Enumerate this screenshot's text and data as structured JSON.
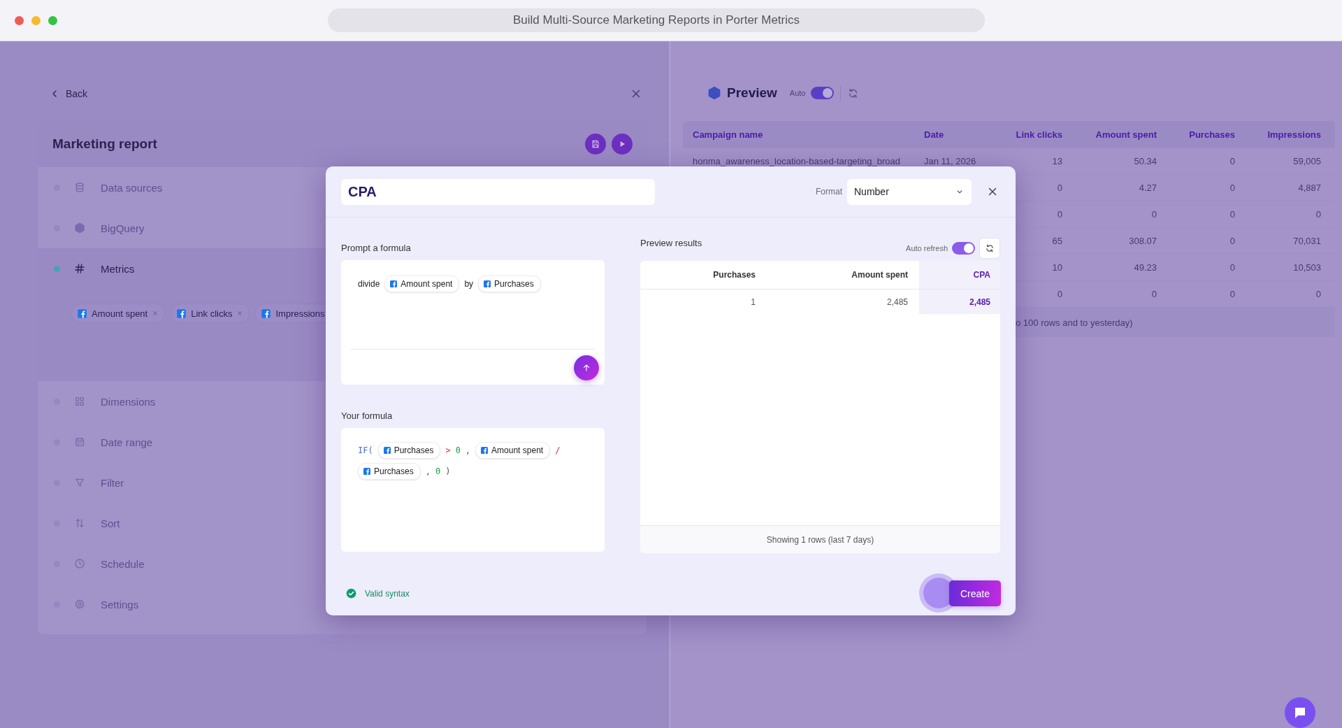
{
  "window": {
    "title": "Build Multi-Source Marketing Reports in Porter Metrics"
  },
  "editor": {
    "back": "Back",
    "report_title": "Marketing report",
    "sections": [
      {
        "kind": "database",
        "label": "Data sources",
        "active": false
      },
      {
        "kind": "bigquery",
        "label": "BigQuery",
        "active": false
      },
      {
        "kind": "hash",
        "label": "Metrics",
        "active": true,
        "chips": [
          "Amount spent",
          "Link clicks",
          "Impressions"
        ]
      },
      {
        "kind": "grid",
        "label": "Dimensions",
        "active": false
      },
      {
        "kind": "calendar",
        "label": "Date range",
        "active": false
      },
      {
        "kind": "filter",
        "label": "Filter",
        "active": false
      },
      {
        "kind": "sort",
        "label": "Sort",
        "active": false
      },
      {
        "kind": "clock",
        "label": "Schedule",
        "active": false
      },
      {
        "kind": "gear",
        "label": "Settings",
        "active": false
      }
    ]
  },
  "preview": {
    "title": "Preview",
    "auto_label": "Auto",
    "auto_on": true,
    "table": {
      "columns": [
        "Campaign name",
        "Date",
        "Link clicks",
        "Amount spent",
        "Purchases",
        "Impressions"
      ],
      "rows": [
        [
          "honma_awareness_location-based-targeting_broad",
          "Jan 11, 2026",
          "13",
          "50.34",
          "0",
          "59,005"
        ],
        [
          "0",
          "4.27",
          "0",
          "4,887"
        ],
        [
          "0",
          "0",
          "0",
          "0"
        ],
        [
          "65",
          "308.07",
          "0",
          "70,031"
        ],
        [
          "10",
          "49.23",
          "0",
          "10,503"
        ],
        [
          "0",
          "0",
          "0",
          "0"
        ]
      ]
    },
    "footnote": "o 100 rows and to yesterday)"
  },
  "dialog": {
    "name": "CPA",
    "format_label": "Format",
    "format": "Number",
    "prompt_label": "Prompt a formula",
    "prompt": [
      {
        "kind": "word",
        "text": "divide"
      },
      {
        "kind": "metric",
        "text": "Amount spent"
      },
      {
        "kind": "word",
        "text": "by"
      },
      {
        "kind": "metric",
        "text": "Purchases"
      }
    ],
    "formula_label": "Your formula",
    "formula": [
      {
        "kind": "func",
        "text": "IF("
      },
      {
        "kind": "metric",
        "text": "Purchases"
      },
      {
        "kind": "op",
        "text": ">"
      },
      {
        "kind": "num",
        "text": "0"
      },
      {
        "kind": "punct",
        "text": ","
      },
      {
        "kind": "metric",
        "text": "Amount spent"
      },
      {
        "kind": "op",
        "text": "/"
      },
      {
        "kind": "metric",
        "text": "Purchases"
      },
      {
        "kind": "punct",
        "text": ","
      },
      {
        "kind": "num",
        "text": "0"
      },
      {
        "kind": "punct",
        "text": ")"
      }
    ],
    "results_label": "Preview results",
    "auto_refresh_label": "Auto refresh",
    "auto_refresh": true,
    "results": {
      "columns": [
        {
          "label": "Purchases",
          "highlighted": false
        },
        {
          "label": "Amount spent",
          "highlighted": false
        },
        {
          "label": "CPA",
          "highlighted": true
        }
      ],
      "rows": [
        [
          "1",
          "2,485",
          "2,485"
        ]
      ],
      "footer": "Showing 1 rows (last 7 days)"
    },
    "syntax": {
      "valid": true,
      "text": "Valid syntax"
    },
    "create": "Create"
  }
}
